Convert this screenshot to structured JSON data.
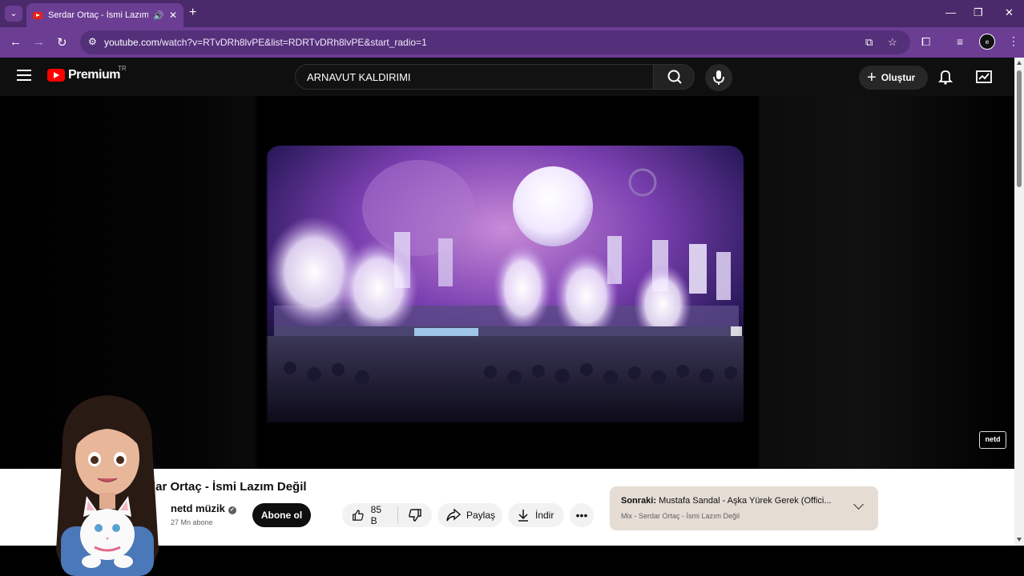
{
  "browser": {
    "tab_title": "Serdar Ortaç - İsmi Lazım D",
    "tab_list_icon": "chevron-down-icon",
    "url_host": "youtube.com",
    "url_rest": "/watch?v=RTvDRh8lvPE&list=RDRTvDRh8lvPE&start_radio=1",
    "profile_label": "e"
  },
  "youtube": {
    "logo_text": "Premium",
    "country_code": "TR",
    "search_value": "ARNAVUT KALDIRIMI",
    "create_label": "Oluştur"
  },
  "player": {
    "watermark": "netd"
  },
  "video": {
    "title": "Serdar Ortaç - İsmi Lazım Değil",
    "title_visible": "dar Ortaç - İsmi Lazım Değil",
    "channel": "netd müzik",
    "subscribers": "27 Mn abone",
    "subscribe_label": "Abone ol",
    "likes": "85 B",
    "share_label": "Paylaş",
    "download_label": "İndir"
  },
  "up_next": {
    "prefix": "Sonraki:",
    "title": "Mustafa Sandal - Aşka Yürek Gerek (Offici...",
    "subtitle": "Mix - Serdar Ortaç - İsmi Lazım Değil"
  },
  "colors": {
    "browser_frame": "#4b2a6b",
    "toolbar": "#6b3d93",
    "youtube_bg": "#0f0f0f",
    "brand_red": "#ff0000"
  }
}
